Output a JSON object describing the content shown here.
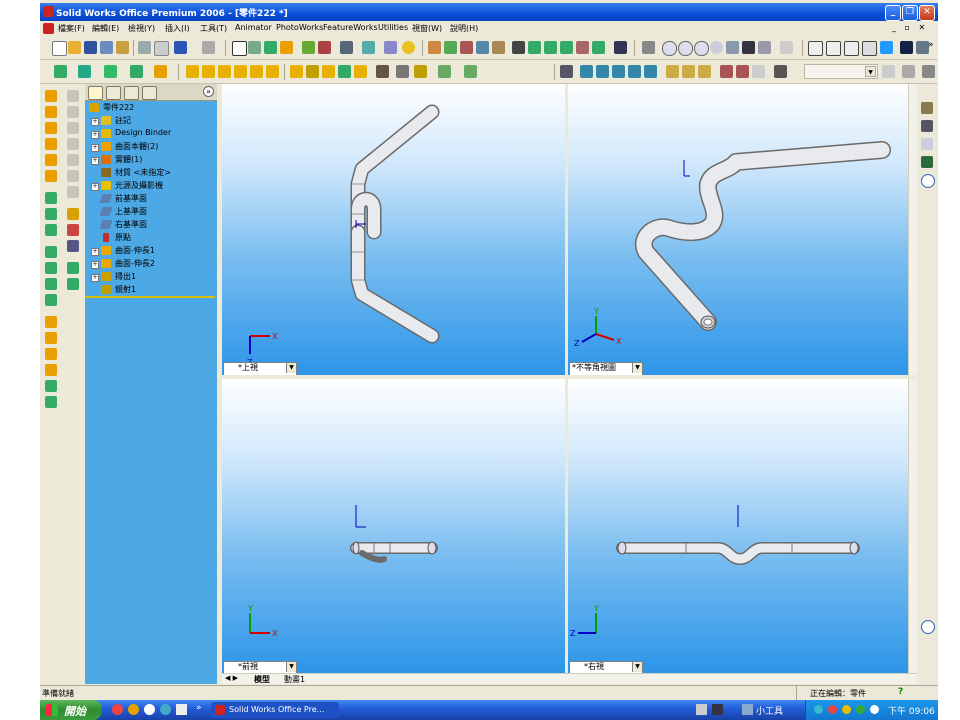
{
  "window": {
    "title": "Solid Works Office Premium 2006 - [零件222 *]",
    "minimize_symbol": "_",
    "restore_symbol": "❐",
    "close_symbol": "✕",
    "doc_controls": "_ ▫ ✕"
  },
  "menu": [
    "檔案(F)",
    "編輯(E)",
    "檢視(Y)",
    "插入(I)",
    "工具(T)",
    "Animator",
    "PhotoWorks",
    "FeatureWorks",
    "Utilities",
    "視窗(W)",
    "說明(H)"
  ],
  "tree": {
    "tab_collapse_symbol": "»",
    "items": [
      {
        "label": "零件222",
        "expander": "",
        "icon": "part-icon",
        "color": "#d9a400"
      },
      {
        "label": "註記",
        "expander": "+",
        "icon": "annotations-icon",
        "color": "#e0c020"
      },
      {
        "label": "Design Binder",
        "expander": "+",
        "icon": "design-binder-icon",
        "color": "#e8b800"
      },
      {
        "label": "曲面本體(2)",
        "expander": "+",
        "icon": "surface-bodies-icon",
        "color": "#f0a000"
      },
      {
        "label": "實體(1)",
        "expander": "+",
        "icon": "solid-bodies-icon",
        "color": "#d97000"
      },
      {
        "label": "材質 <未指定>",
        "expander": "",
        "icon": "material-icon",
        "color": "#8a6a20"
      },
      {
        "label": "光源及攝影機",
        "expander": "+",
        "icon": "lights-cameras-icon",
        "color": "#e8c000"
      },
      {
        "label": "前基準面",
        "expander": "",
        "icon": "plane-icon",
        "color": "#5a7fb0"
      },
      {
        "label": "上基準面",
        "expander": "",
        "icon": "plane-icon",
        "color": "#5a7fb0"
      },
      {
        "label": "右基準面",
        "expander": "",
        "icon": "plane-icon",
        "color": "#5a7fb0"
      },
      {
        "label": "原點",
        "expander": "",
        "icon": "origin-icon",
        "color": "#c03030"
      },
      {
        "label": "曲面-伸長1",
        "expander": "+",
        "icon": "surface-extrude-icon",
        "color": "#e8a800"
      },
      {
        "label": "曲面-伸長2",
        "expander": "+",
        "icon": "surface-extrude-icon",
        "color": "#e8a800"
      },
      {
        "label": "掃出1",
        "expander": "+",
        "icon": "sweep-icon",
        "color": "#d0a000"
      },
      {
        "label": "鏡射1",
        "expander": "",
        "icon": "mirror-icon",
        "color": "#c0a000"
      }
    ]
  },
  "viewports": {
    "top_left": {
      "view": "*上視"
    },
    "top_right": {
      "view": "*不等角視圖"
    },
    "bottom_left": {
      "view": "*前視"
    },
    "bottom_right": {
      "view": "*右視"
    }
  },
  "triad": {
    "x": "X",
    "y": "Y",
    "z": "Z",
    "x_color": "#d40000",
    "y_color": "#00a000",
    "z_color": "#0000c8"
  },
  "bottom_tabs": {
    "nav": "◀ ▶",
    "model": "模型",
    "motion": "動畫1"
  },
  "status": {
    "left": "準備就緒",
    "editing": "正在編輯：零件",
    "help": "?"
  },
  "taskbar": {
    "start": "開始",
    "quicklaunch_more": "»",
    "task_label": "Solid Works Office Pre...",
    "toolbar_label": "小工具",
    "clock": "下午 09:06"
  },
  "colors": {
    "titlebar": "#0a4fd8",
    "tree_bg": "#4da9e6",
    "pipe": "#e4e6ea"
  }
}
